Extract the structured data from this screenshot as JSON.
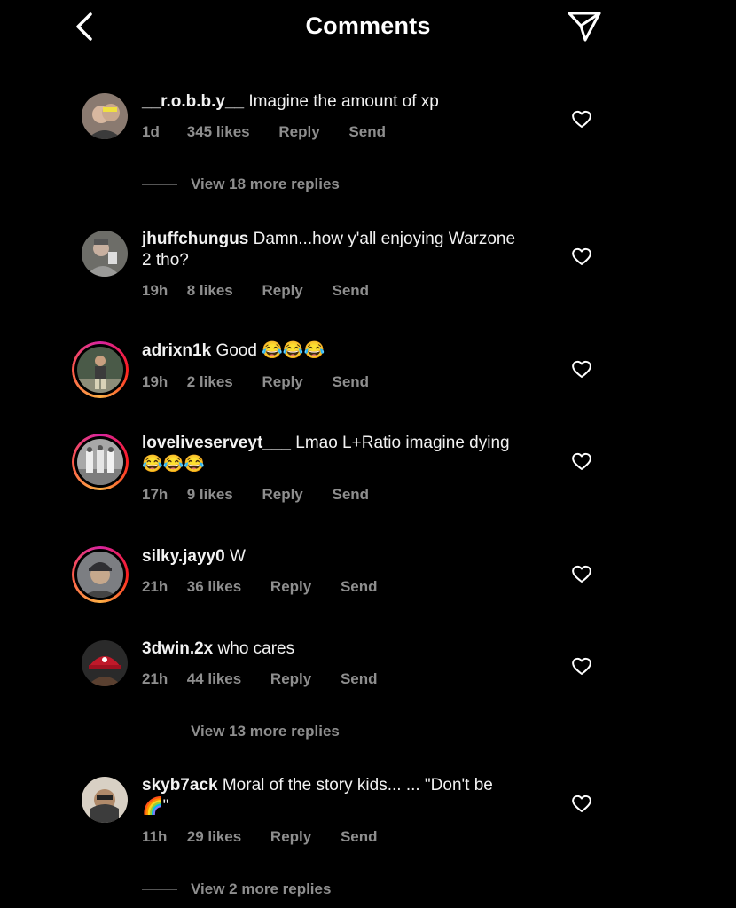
{
  "header": {
    "title": "Comments"
  },
  "comments": [
    {
      "user": "__r.o.b.b.y__",
      "text": "Imagine the amount of xp",
      "time": "1d",
      "likes": "345 likes",
      "reply": "Reply",
      "send": "Send",
      "view_replies": "View 18 more replies"
    },
    {
      "user": "jhuffchungus",
      "text": "Damn...how y'all enjoying Warzone 2 tho?",
      "time": "19h",
      "likes": "8 likes",
      "reply": "Reply",
      "send": "Send"
    },
    {
      "user": "adrixn1k",
      "text": "Good 😂😂😂",
      "time": "19h",
      "likes": "2 likes",
      "reply": "Reply",
      "send": "Send"
    },
    {
      "user": "loveliveserveyt___",
      "text": "Lmao L+Ratio imagine dying😂😂😂",
      "time": "17h",
      "likes": "9 likes",
      "reply": "Reply",
      "send": "Send"
    },
    {
      "user": "silky.jayy0",
      "text": "W",
      "time": "21h",
      "likes": "36 likes",
      "reply": "Reply",
      "send": "Send"
    },
    {
      "user": "3dwin.2x",
      "text": "who cares",
      "time": "21h",
      "likes": "44 likes",
      "reply": "Reply",
      "send": "Send",
      "view_replies": "View 13 more replies"
    },
    {
      "user": "skyb7ack",
      "text": "Moral of the story kids... ... \"Don't be 🌈\"",
      "time": "11h",
      "likes": "29 likes",
      "reply": "Reply",
      "send": "Send",
      "view_replies": "View 2 more replies"
    }
  ],
  "icons": {
    "back": "chevron-left-icon",
    "send": "paper-plane-icon",
    "like": "heart-icon"
  },
  "colors": {
    "background": "#000000",
    "text": "#ffffff",
    "muted": "#8e8e8e"
  }
}
